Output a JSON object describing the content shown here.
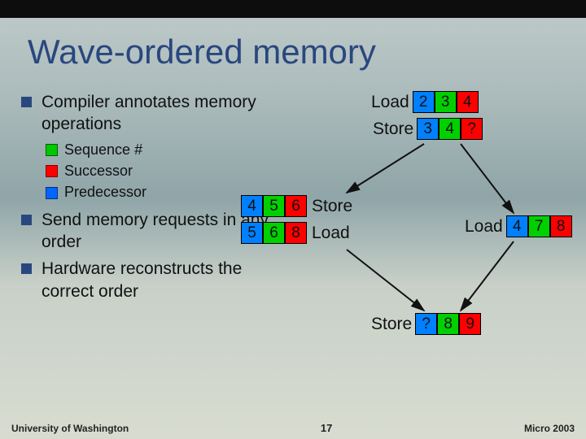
{
  "title": "Wave-ordered memory",
  "bullets": {
    "b0": "Compiler annotates memory operations",
    "sub": {
      "s0": "Sequence #",
      "s1": "Successor",
      "s2": "Predecessor"
    },
    "b1": "Send memory requests in any order",
    "b2": "Hardware reconstructs the correct order"
  },
  "ops": {
    "top_load": {
      "label": "Load",
      "c": [
        "2",
        "3",
        "4"
      ]
    },
    "top_store": {
      "label": "Store",
      "c": [
        "3",
        "4",
        "?"
      ]
    },
    "left_store": {
      "label": "Store",
      "c": [
        "4",
        "5",
        "6"
      ]
    },
    "left_load": {
      "label": "Load",
      "c": [
        "5",
        "6",
        "8"
      ]
    },
    "right_load": {
      "label": "Load",
      "c": [
        "4",
        "7",
        "8"
      ]
    },
    "bottom_store": {
      "label": "Store",
      "c": [
        "?",
        "8",
        "9"
      ]
    }
  },
  "footer": {
    "left": "University of Washington",
    "page": "17",
    "right": "Micro 2003"
  }
}
